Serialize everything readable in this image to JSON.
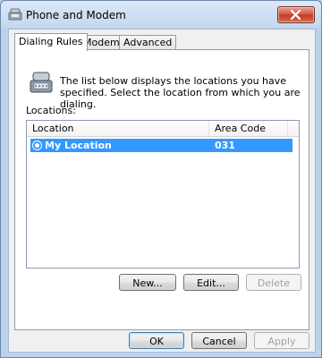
{
  "window": {
    "title": "Phone and Modem"
  },
  "tabs": [
    {
      "label": "Dialing Rules",
      "active": true
    },
    {
      "label": "Modems",
      "active": false
    },
    {
      "label": "Advanced",
      "active": false
    }
  ],
  "dialing_rules": {
    "description": "The list below displays the locations you have specified. Select the location from which you are dialing.",
    "locations_label": "Locations:",
    "columns": [
      "Location",
      "Area Code"
    ],
    "rows": [
      {
        "location": "My Location",
        "area_code": "031",
        "selected": true
      }
    ],
    "buttons": {
      "new": "New...",
      "edit": "Edit...",
      "delete": "Delete"
    }
  },
  "footer": {
    "ok": "OK",
    "cancel": "Cancel",
    "apply": "Apply"
  },
  "colors": {
    "selection": "#3399ff",
    "close_button": "#c8452f",
    "frame": "#bcd2ec"
  },
  "icons": [
    "phone-modem-icon",
    "close-icon",
    "radio-selected-icon"
  ]
}
